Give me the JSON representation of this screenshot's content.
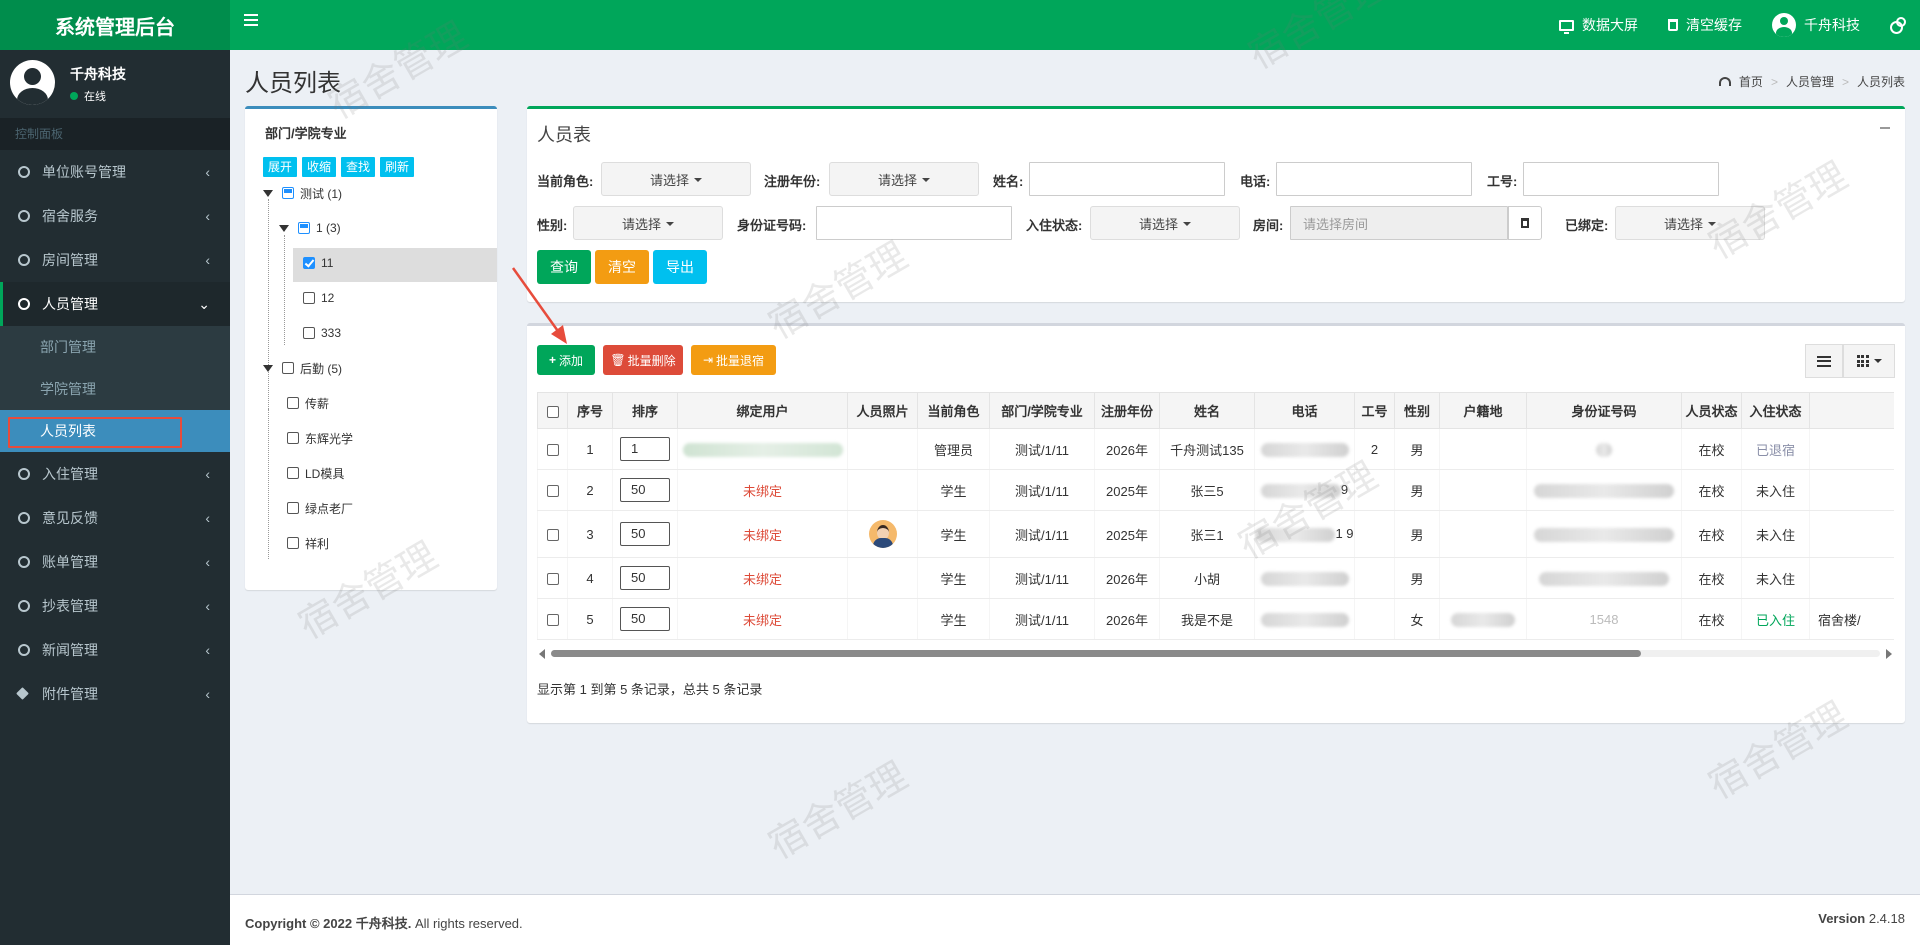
{
  "app": {
    "title": "系统管理后台",
    "top_items": {
      "screen": "数据大屏",
      "clear_cache": "清空缓存",
      "user": "千舟科技"
    },
    "accent": "#00a65a"
  },
  "sidebar": {
    "user_name": "千舟科技",
    "status": "在线",
    "header": "控制面板",
    "items": [
      {
        "label": "单位账号管理"
      },
      {
        "label": "宿舍服务"
      },
      {
        "label": "房间管理"
      },
      {
        "label": "人员管理",
        "expanded": true,
        "children": [
          "部门管理",
          "学院管理",
          "人员列表"
        ]
      },
      {
        "label": "入住管理"
      },
      {
        "label": "意见反馈"
      },
      {
        "label": "账单管理"
      },
      {
        "label": "抄表管理"
      },
      {
        "label": "新闻管理"
      },
      {
        "label": "附件管理"
      }
    ]
  },
  "page": {
    "title": "人员列表",
    "breadcrumb": [
      "首页",
      "人员管理",
      "人员列表"
    ]
  },
  "tree": {
    "title": "部门/学院专业",
    "buttons": [
      "展开",
      "收缩",
      "查找",
      "刷新"
    ],
    "nodes": [
      {
        "label": "测试 (1)"
      },
      {
        "label": "1 (3)"
      },
      {
        "label": "11",
        "checked": true
      },
      {
        "label": "12"
      },
      {
        "label": "333"
      },
      {
        "label": "后勤 (5)"
      },
      {
        "label": "传薪"
      },
      {
        "label": "东辉光学"
      },
      {
        "label": "LD模具"
      },
      {
        "label": "绿点老厂"
      },
      {
        "label": "祥利"
      }
    ]
  },
  "search": {
    "title": "人员表",
    "labels": {
      "role": "当前角色:",
      "year": "注册年份:",
      "name": "姓名:",
      "phone": "电话:",
      "work_no": "工号:",
      "gender": "性别:",
      "id_no": "身份证号码:",
      "checkin": "入住状态:",
      "room": "房间:",
      "bound": "已绑定:"
    },
    "select_placeholder": "请选择",
    "room_placeholder": "请选择房间",
    "buttons": {
      "query": "查询",
      "clear": "清空",
      "export": "导出"
    }
  },
  "toolbar": {
    "add": "添加",
    "batch_delete": "批量删除",
    "batch_checkout": "批量退宿"
  },
  "table": {
    "columns": [
      "序号",
      "排序",
      "绑定用户",
      "人员照片",
      "当前角色",
      "部门/学院专业",
      "注册年份",
      "姓名",
      "电话",
      "工号",
      "性别",
      "户籍地",
      "身份证号码",
      "人员状态",
      "入住状态",
      ""
    ],
    "rows": [
      {
        "no": "1",
        "order": "1",
        "user": "",
        "photo": false,
        "role": "管理员",
        "dept": "测试/1/11",
        "year": "2026年",
        "name": "千舟测试135",
        "phone_visible": "",
        "work_no": "2",
        "gender": "男",
        "hometown": "",
        "id_visible": "",
        "status": "在校",
        "checkin": "已退宿",
        "room": ""
      },
      {
        "no": "2",
        "order": "50",
        "user": "未绑定",
        "photo": false,
        "role": "学生",
        "dept": "测试/1/11",
        "year": "2025年",
        "name": "张三5",
        "phone_visible": "9",
        "work_no": "",
        "gender": "男",
        "hometown": "",
        "id_visible": "",
        "status": "在校",
        "checkin": "未入住",
        "room": ""
      },
      {
        "no": "3",
        "order": "50",
        "user": "未绑定",
        "photo": true,
        "role": "学生",
        "dept": "测试/1/11",
        "year": "2025年",
        "name": "张三1",
        "phone_visible": "1 9",
        "work_no": "",
        "gender": "男",
        "hometown": "",
        "id_visible": "",
        "status": "在校",
        "checkin": "未入住",
        "room": ""
      },
      {
        "no": "4",
        "order": "50",
        "user": "未绑定",
        "photo": false,
        "role": "学生",
        "dept": "测试/1/11",
        "year": "2026年",
        "name": "小胡",
        "phone_visible": "",
        "work_no": "",
        "gender": "男",
        "hometown": "",
        "id_visible": "",
        "status": "在校",
        "checkin": "未入住",
        "room": ""
      },
      {
        "no": "5",
        "order": "50",
        "user": "未绑定",
        "photo": false,
        "role": "学生",
        "dept": "测试/1/11",
        "year": "2026年",
        "name": "我是不是",
        "phone_visible": "",
        "work_no": "",
        "gender": "女",
        "hometown": "",
        "id_visible": "1548",
        "status": "在校",
        "checkin": "已入住",
        "room": "宿舍楼/"
      }
    ],
    "pagination": "显示第 1 到第 5 条记录，总共 5 条记录"
  },
  "footer": {
    "copyright_prefix": "Copyright © 2022",
    "company": "千舟科技.",
    "rights": "All rights reserved.",
    "version_label": "Version",
    "version": "2.4.18"
  },
  "watermark": "宿舍管理"
}
